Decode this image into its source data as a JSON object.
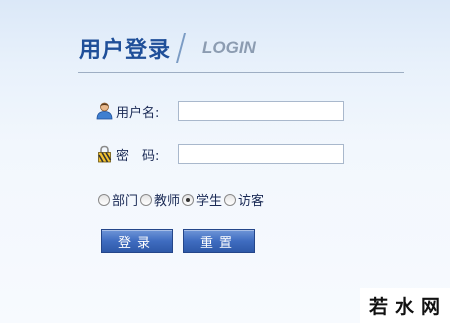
{
  "header": {
    "title_cn": "用户登录",
    "title_en": "LOGIN"
  },
  "form": {
    "username_label": "用户名:",
    "username_value": "",
    "password_label": "密　码:",
    "password_value": ""
  },
  "roles": [
    {
      "label": "部门",
      "checked": false
    },
    {
      "label": "教师",
      "checked": false
    },
    {
      "label": "学生",
      "checked": true
    },
    {
      "label": "访客",
      "checked": false
    }
  ],
  "buttons": {
    "login": "登录",
    "reset": "重置"
  },
  "watermark": "若水网",
  "colors": {
    "accent": "#1f4f99",
    "button": "#3f6cc0",
    "background": "#e8f1fb"
  }
}
